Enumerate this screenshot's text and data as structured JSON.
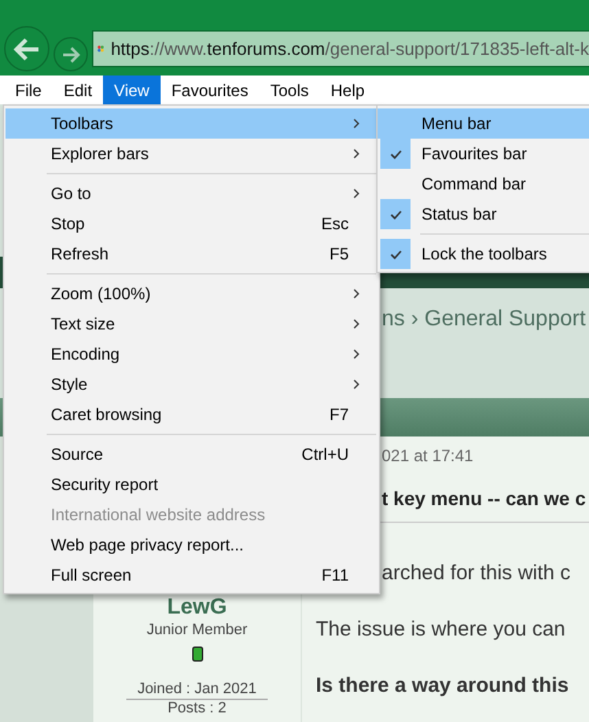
{
  "address_bar": {
    "url_parts": [
      {
        "text": "https",
        "emphasis": true
      },
      {
        "text": "://www.",
        "emphasis": false
      },
      {
        "text": "tenforums.com",
        "emphasis": true
      },
      {
        "text": "/general-support/171835-left-alt-k",
        "emphasis": false
      }
    ]
  },
  "menubar": [
    {
      "label": "File",
      "selected": false
    },
    {
      "label": "Edit",
      "selected": false
    },
    {
      "label": "View",
      "selected": true
    },
    {
      "label": "Favourites",
      "selected": false
    },
    {
      "label": "Tools",
      "selected": false
    },
    {
      "label": "Help",
      "selected": false
    }
  ],
  "view_menu": [
    {
      "kind": "item",
      "label": "Toolbars",
      "submenu": true,
      "selected": true,
      "disabled": false
    },
    {
      "kind": "item",
      "label": "Explorer bars",
      "submenu": true,
      "selected": false,
      "disabled": false
    },
    {
      "kind": "separator"
    },
    {
      "kind": "item",
      "label": "Go to",
      "submenu": true,
      "selected": false,
      "disabled": false
    },
    {
      "kind": "item",
      "label": "Stop",
      "shortcut": "Esc",
      "submenu": false,
      "selected": false,
      "disabled": false
    },
    {
      "kind": "item",
      "label": "Refresh",
      "shortcut": "F5",
      "submenu": false,
      "selected": false,
      "disabled": false
    },
    {
      "kind": "separator"
    },
    {
      "kind": "item",
      "label": "Zoom (100%)",
      "submenu": true,
      "selected": false,
      "disabled": false
    },
    {
      "kind": "item",
      "label": "Text size",
      "submenu": true,
      "selected": false,
      "disabled": false
    },
    {
      "kind": "item",
      "label": "Encoding",
      "submenu": true,
      "selected": false,
      "disabled": false
    },
    {
      "kind": "item",
      "label": "Style",
      "submenu": true,
      "selected": false,
      "disabled": false
    },
    {
      "kind": "item",
      "label": "Caret browsing",
      "shortcut": "F7",
      "submenu": false,
      "selected": false,
      "disabled": false
    },
    {
      "kind": "separator"
    },
    {
      "kind": "item",
      "label": "Source",
      "shortcut": "Ctrl+U",
      "submenu": false,
      "selected": false,
      "disabled": false
    },
    {
      "kind": "item",
      "label": "Security report",
      "submenu": false,
      "selected": false,
      "disabled": false
    },
    {
      "kind": "item",
      "label": "International website address",
      "submenu": false,
      "selected": false,
      "disabled": true
    },
    {
      "kind": "item",
      "label": "Web page privacy report...",
      "submenu": false,
      "selected": false,
      "disabled": false
    },
    {
      "kind": "item",
      "label": "Full screen",
      "shortcut": "F11",
      "submenu": false,
      "selected": false,
      "disabled": false
    }
  ],
  "toolbars_submenu": [
    {
      "kind": "item",
      "label": "Menu bar",
      "checked": false,
      "selected": true
    },
    {
      "kind": "item",
      "label": "Favourites bar",
      "checked": true,
      "selected": false
    },
    {
      "kind": "item",
      "label": "Command bar",
      "checked": false,
      "selected": false
    },
    {
      "kind": "item",
      "label": "Status bar",
      "checked": true,
      "selected": false
    },
    {
      "kind": "separator"
    },
    {
      "kind": "item",
      "label": "Lock the toolbars",
      "checked": true,
      "selected": false
    }
  ],
  "page": {
    "breadcrumb": "ns › General Support",
    "post_date": "021 at 17:41",
    "post_title": "t key menu -- can we c",
    "user": {
      "name": "LewG",
      "rank": "Junior Member",
      "online": true,
      "joined": "Joined : Jan 2021",
      "posts": "Posts : 2"
    },
    "paragraphs": [
      {
        "text": "arched for this with c",
        "bold": false,
        "covered": true
      },
      {
        "text": "The issue is where you can",
        "bold": false,
        "covered": false
      },
      {
        "text": "Is there a way around this",
        "bold": true,
        "covered": false
      }
    ]
  }
}
